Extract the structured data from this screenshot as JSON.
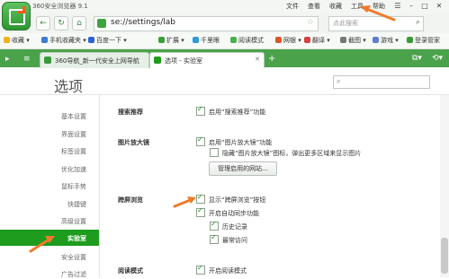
{
  "titlebar": {
    "title": "360安全浏览器 9.1",
    "menus": [
      "文件",
      "查看",
      "收藏",
      "工具",
      "帮助"
    ],
    "win_buttons": [
      "☰",
      "–",
      "□",
      "✕"
    ]
  },
  "navbar": {
    "back": "←",
    "refresh": "↻",
    "home": "⌂",
    "url": "se://settings/lab",
    "search_placeholder": "点此搜索"
  },
  "bookmarks": {
    "items": [
      "收藏",
      "手机收藏夹",
      "百度一下"
    ],
    "tools": [
      "扩展",
      "千里眼",
      "阅读模式",
      "网银",
      "翻译",
      "截图",
      "游戏",
      "登录管家"
    ]
  },
  "tabs": [
    {
      "label": "360导航_新一代安全上网导航",
      "active": false
    },
    {
      "label": "选项 - 实验室",
      "active": true
    }
  ],
  "page": {
    "title": "选项",
    "search_value": ""
  },
  "sidebar": {
    "items": [
      "基本设置",
      "界面设置",
      "标签设置",
      "优化加速",
      "鼠标手势",
      "快捷键",
      "高级设置",
      "实验室",
      "安全设置",
      "广告过滤"
    ],
    "active": "实验室"
  },
  "sections": {
    "search_rec": {
      "label": "搜索推荐",
      "option": "启用“搜索推荐”功能"
    },
    "img_zoom": {
      "label": "图片放大镜",
      "opt1": "启用“图片放大镜”功能",
      "opt2": "隐藏“图片放大镜”图标，弹出更多区域来显示图片",
      "button": "管理启用的网站..."
    },
    "cross_screen": {
      "label": "跨屏浏览",
      "opt1": "显示“跨屏浏览”按钮",
      "opt2": "开启自动同步功能",
      "opt3": "历史记录",
      "opt4": "最常访问"
    },
    "reading": {
      "label": "阅读模式",
      "opt1": "开启阅读模式"
    }
  },
  "colors": {
    "accent": "#1e9c1e",
    "tabbar": "#4aa24a",
    "arrow": "#f07a2a"
  }
}
